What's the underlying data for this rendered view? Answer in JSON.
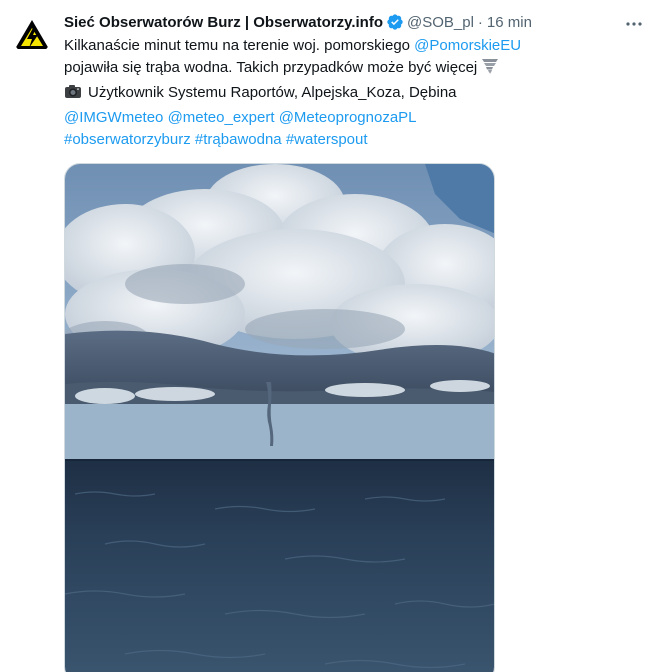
{
  "tweet": {
    "display_name": "Sieć Obserwatorów Burz | Obserwatorzy.info",
    "handle": "@SOB_pl",
    "separator": "·",
    "time": "16 min",
    "line1_text": "Kilkanaście minut temu na terenie woj. pomorskiego ",
    "line1_mention": "@PomorskieEU",
    "line2_text": "pojawiła się trąba wodna. Takich przypadków może być więcej",
    "line3_text": "Użytkownik Systemu Raportów, Alpejska_Koza, Dębina",
    "mentions": [
      "@IMGWmeteo",
      "@meteo_expert",
      "@MeteoprognozaPL"
    ],
    "hashtags": [
      "#obserwatorzyburz",
      "#trąbawodna",
      "#waterspout"
    ]
  },
  "icons": {
    "avatar": "lightning-triangle-logo-icon",
    "verified": "verified-badge-icon",
    "more": "more-dots-icon",
    "tornado": "tornado-emoji-icon",
    "camera": "camera-emoji-icon"
  },
  "colors": {
    "link": "#1d9bf0",
    "secondary_text": "#536471",
    "verified": "#1d9bf0"
  }
}
